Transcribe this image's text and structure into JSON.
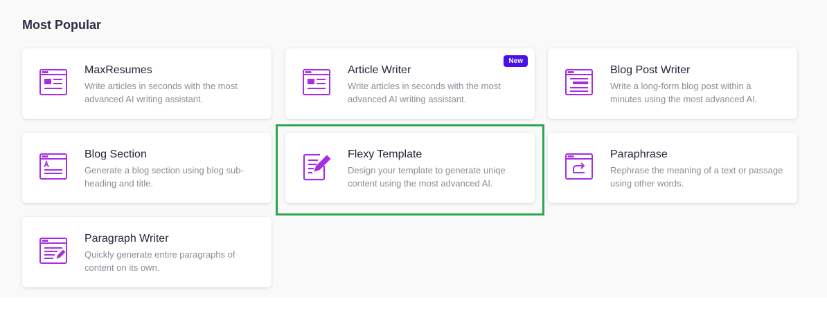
{
  "section": {
    "title": "Most Popular"
  },
  "accent_color": "#a62ee0",
  "cards": [
    {
      "title": "MaxResumes",
      "desc": "Write articles in seconds with the most advanced AI writing assistant.",
      "icon": "article-document-icon"
    },
    {
      "title": "Article Writer",
      "desc": "Write articles in seconds with the most advanced AI writing assistant.",
      "icon": "article-document-icon",
      "badge": "New"
    },
    {
      "title": "Blog Post Writer",
      "desc": "Write a long-form blog post within a minutes using the most advanced AI.",
      "icon": "blog-post-icon"
    },
    {
      "title": "Blog Section",
      "desc": "Generate a blog section using blog sub-heading and title.",
      "icon": "blog-section-icon"
    },
    {
      "title": "Flexy Template",
      "desc": "Design your template to generate uniqe content using the most advanced AI.",
      "icon": "edit-document-icon"
    },
    {
      "title": "Paraphrase",
      "desc": "Rephrase the meaning of a text or passage using other words.",
      "icon": "paraphrase-icon"
    },
    {
      "title": "Paragraph Writer",
      "desc": "Quickly generate entire paragraphs of content on its own.",
      "icon": "paragraph-edit-icon"
    }
  ]
}
